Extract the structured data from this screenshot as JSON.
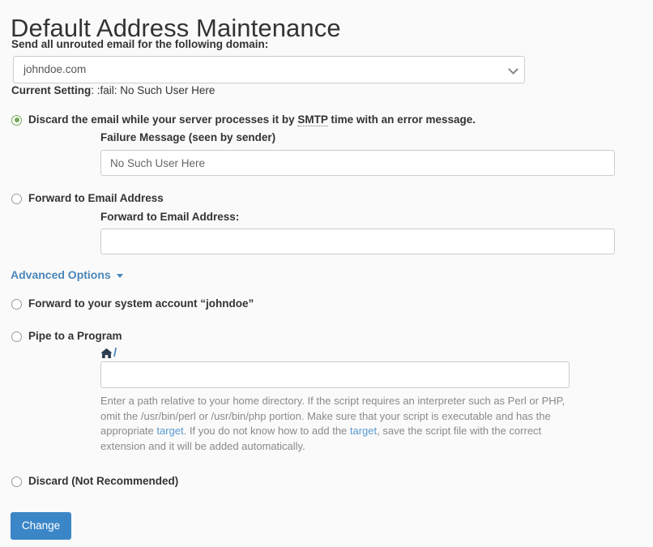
{
  "page": {
    "title": "Default Address Maintenance"
  },
  "domain": {
    "label": "Send all unrouted email for the following domain:",
    "selected": "johndoe.com",
    "options": [
      "johndoe.com"
    ],
    "chevron_icon": "chevron-down-icon"
  },
  "current_setting": {
    "label": "Current Setting",
    "separator": ": ",
    "value": ":fail: No Such User Here"
  },
  "options": {
    "discard_smtp": {
      "text_before": "Discard the email while your server processes it by ",
      "abbr": "SMTP",
      "text_after": " time with an error message.",
      "checked": true,
      "failure_label": "Failure Message (seen by sender)",
      "failure_value": "No Such User Here",
      "failure_placeholder": ""
    },
    "forward_email": {
      "label": "Forward to Email Address",
      "checked": false,
      "sub_label": "Forward to Email Address:",
      "value": "",
      "placeholder": ""
    },
    "forward_system": {
      "label": "Forward to your system account “johndoe”",
      "checked": false
    },
    "pipe_program": {
      "label": "Pipe to a Program",
      "checked": false,
      "home_icon": "home-icon",
      "path_prefix": "/",
      "value": "",
      "placeholder": "",
      "help_part_1": "Enter a path relative to your home directory. If the script requires an interpreter such as Perl or PHP, omit the /usr/bin/perl or /usr/bin/php portion. Make sure that your script is executable and has the appropriate ",
      "help_link_1": "target",
      "help_part_2": ". If you do not know how to add the ",
      "help_link_2": "target",
      "help_part_3": ", save the script file with the correct extension and it will be added automatically."
    },
    "discard": {
      "label": "Discard (Not Recommended)",
      "checked": false
    }
  },
  "advanced_options": {
    "label": "Advanced Options",
    "caret_icon": "caret-down-icon"
  },
  "submit": {
    "label": "Change"
  },
  "colors": {
    "page_background": "#fafafa",
    "accent_link": "#4a86b8",
    "radio_checked": "#72a85c",
    "button_primary": "#3b86c7",
    "help_text": "#8a8a8a"
  }
}
